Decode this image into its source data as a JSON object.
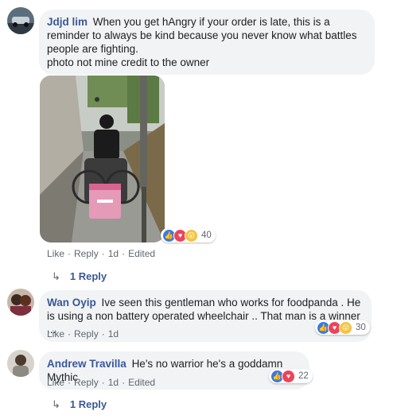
{
  "comments": [
    {
      "author": "Jdjd lim",
      "text": "When you get hAngry if your order is late, this is a reminder to always be kind because you never know what battles people are fighting.",
      "credit": "photo not mine credit to the owner",
      "reactions": {
        "icons": [
          "like-icon",
          "love-icon",
          "wow-icon"
        ],
        "count": "40"
      },
      "actions": {
        "like": "Like",
        "reply": "Reply",
        "time": "1d",
        "edited": "Edited"
      },
      "replies_label": "1 Reply"
    },
    {
      "author": "Wan Oyip",
      "text": "Ive seen this gentleman who works for foodpanda . He is using a non battery operated wheelchair .. That man is a winner ...",
      "reactions": {
        "icons": [
          "like-icon",
          "love-icon",
          "wow-icon"
        ],
        "count": "30"
      },
      "actions": {
        "like": "Like",
        "reply": "Reply",
        "time": "1d"
      }
    },
    {
      "author": "Andrew Travilla",
      "text": "He's no warrior he's a goddamn Mythic",
      "reactions": {
        "icons": [
          "like-icon",
          "love-icon"
        ],
        "count": "22"
      },
      "actions": {
        "like": "Like",
        "reply": "Reply",
        "time": "1d",
        "edited": "Edited"
      },
      "replies_label": "1 Reply"
    }
  ],
  "colors": {
    "link": "#385898",
    "bubble": "#f2f3f5",
    "meta": "#606770",
    "like": "#3b7ae0",
    "love": "#ec4459",
    "wow": "#f5c33b"
  }
}
